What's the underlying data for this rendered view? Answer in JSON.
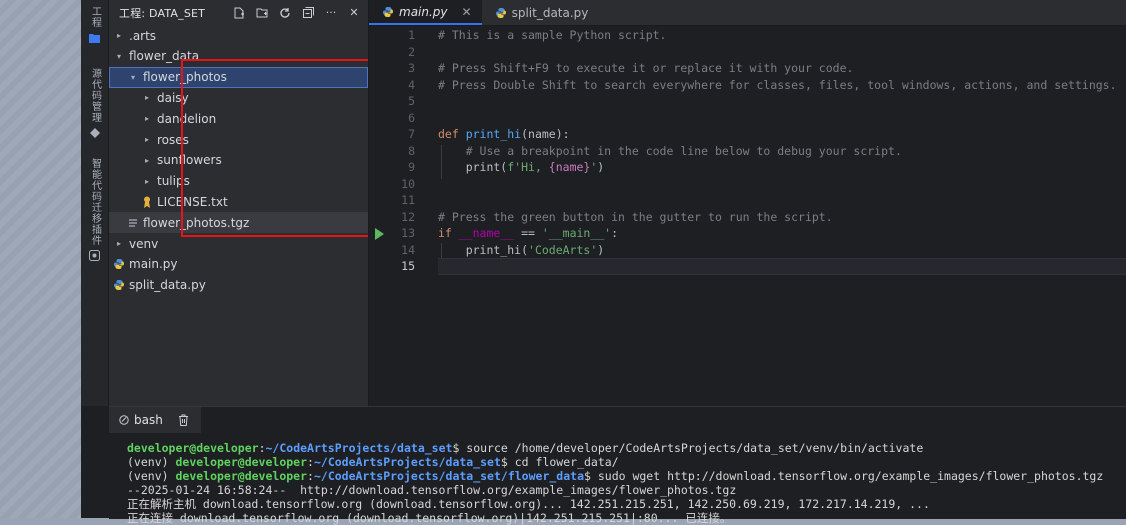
{
  "activity": {
    "project_label": "工程",
    "codecheck_label": "源代码管理",
    "migration_label": "智能代码迁移插件"
  },
  "explorer": {
    "title": "工程: DATA_SET",
    "close_glyph": "✕",
    "more_glyph": "···",
    "tree": [
      {
        "label": ".arts",
        "depth": 1,
        "caret": "▸",
        "icon": "none"
      },
      {
        "label": "flower_data",
        "depth": 1,
        "caret": "▾",
        "icon": "none"
      },
      {
        "label": "flower_photos",
        "depth": 2,
        "caret": "▾",
        "icon": "none"
      },
      {
        "label": "daisy",
        "depth": 3,
        "caret": "▸",
        "icon": "none"
      },
      {
        "label": "dandelion",
        "depth": 3,
        "caret": "▸",
        "icon": "none"
      },
      {
        "label": "roses",
        "depth": 3,
        "caret": "▸",
        "icon": "none"
      },
      {
        "label": "sunflowers",
        "depth": 3,
        "caret": "▸",
        "icon": "none"
      },
      {
        "label": "tulips",
        "depth": 3,
        "caret": "▸",
        "icon": "none"
      },
      {
        "label": "LICENSE.txt",
        "depth": 3,
        "caret": "",
        "icon": "license-icon"
      },
      {
        "label": "flower_photos.tgz",
        "depth": 2,
        "caret": "",
        "icon": "file-lines-icon"
      },
      {
        "label": "venv",
        "depth": 1,
        "caret": "▸",
        "icon": "none"
      },
      {
        "label": "main.py",
        "depth": 1,
        "caret": "",
        "icon": "python-icon"
      },
      {
        "label": "split_data.py",
        "depth": 1,
        "caret": "",
        "icon": "python-icon"
      }
    ]
  },
  "editor": {
    "tabs": [
      {
        "label": "main.py",
        "active": true,
        "close": "✕"
      },
      {
        "label": "split_data.py",
        "active": false
      }
    ],
    "line_numbers": [
      "1",
      "2",
      "3",
      "4",
      "5",
      "6",
      "7",
      "8",
      "9",
      "10",
      "11",
      "12",
      "13",
      "14",
      "15"
    ],
    "code": {
      "l1": "# This is a sample Python script.",
      "l3": "# Press Shift+F9 to execute it or replace it with your code.",
      "l4": "# Press Double Shift to search everywhere for classes, files, tool windows, actions, and settings.",
      "l7_kw": "def ",
      "l7_fn": "print_hi",
      "l7_rest": "(name):",
      "l8": "    # Use a breakpoint in the code line below to debug your script.",
      "l9_a": "    print(",
      "l9_s1": "f'Hi, ",
      "l9_b": "{name}",
      "l9_s2": "'",
      "l9_c": ")",
      "l12": "# Press the green button in the gutter to run the script.",
      "l13_kw": "if ",
      "l13_d": "__name__",
      "l13_op": " == ",
      "l13_s": "'__main__'",
      "l13_end": ":",
      "l14_a": "    print_hi(",
      "l14_s": "'CodeArts'",
      "l14_c": ")"
    }
  },
  "terminal": {
    "tab_label": "bash",
    "user": "developer@developer",
    "lines": [
      {
        "prefix": "",
        "path": "~/CodeArtsProjects/data_set",
        "cmd": "$ source /home/developer/CodeArtsProjects/data_set/venv/bin/activate"
      },
      {
        "prefix": "(venv) ",
        "path": "~/CodeArtsProjects/data_set",
        "cmd": "$ cd flower_data/"
      },
      {
        "prefix": "(venv) ",
        "path": "~/CodeArtsProjects/data_set/flower_data",
        "cmd": "$ sudo wget http://download.tensorflow.org/example_images/flower_photos.tgz"
      }
    ],
    "out1": "--2025-01-24 16:58:24--  http://download.tensorflow.org/example_images/flower_photos.tgz",
    "out2": "正在解析主机 download.tensorflow.org (download.tensorflow.org)... 142.251.215.251, 142.250.69.219, 172.217.14.219, ...",
    "out3": "正在连接 download.tensorflow.org (download.tensorflow.org)|142.251.215.251|:80... 已连接。"
  },
  "colors": {
    "selection": "#2e436e",
    "annotation_box": "#e8141b",
    "run_gutter": "#5fb85f"
  }
}
